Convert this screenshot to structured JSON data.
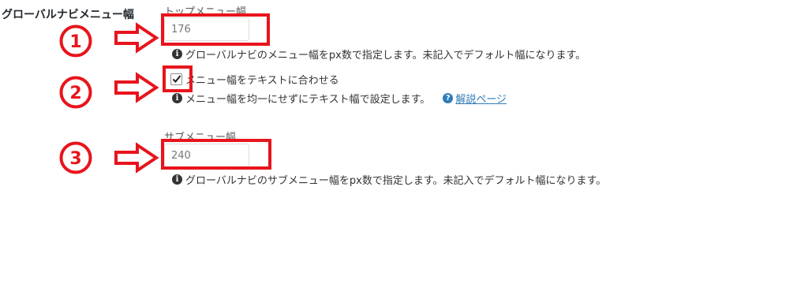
{
  "section": {
    "title": "グローバルナビメニュー幅"
  },
  "top_menu": {
    "label": "トップメニュー幅",
    "value": "176",
    "help": "グローバルナビのメニュー幅をpx数で指定します。未記入でデフォルト幅になります。"
  },
  "fit_text": {
    "label": "メニュー幅をテキストに合わせる",
    "checked": true,
    "help": "メニュー幅を均一にせずにテキスト幅で設定します。",
    "link": "解説ページ"
  },
  "sub_menu": {
    "label": "サブメニュー幅",
    "value": "240",
    "help": "グローバルナビのサブメニュー幅をpx数で指定します。未記入でデフォルト幅になります。"
  },
  "annotations": {
    "markers": [
      "1",
      "2",
      "3"
    ],
    "color": "#e8141c"
  },
  "colors": {
    "link": "#2e7bb8",
    "text": "#333333",
    "input_border": "#dddddd"
  }
}
